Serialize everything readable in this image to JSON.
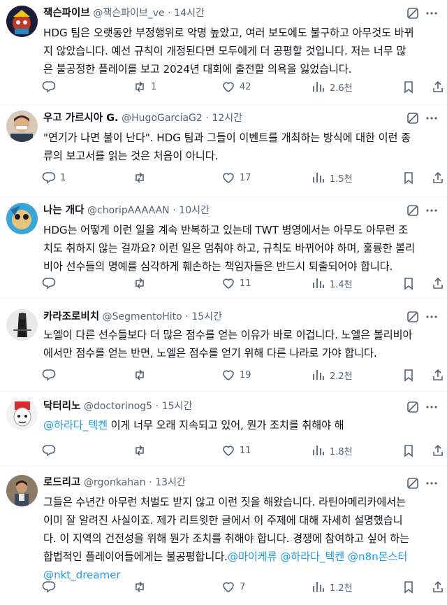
{
  "tweets": [
    {
      "name": "잭슨파이브",
      "handle": "@잭슨파이브_ve",
      "dot": "·",
      "time": "14시간",
      "text": [
        "HDG 팀은 오랫동안 부정행위로 악명 높았고, 여러 보도에도 불구하고 아무것도 바뀌",
        "지 않았습니다. 예선 규칙이 개정된다면 모두에게 더 공평할 것입니다. 저는 너무 많",
        "은 불공정한 플레이를 보고 2024년 대회에 출전할 의욕을 잃었습니다."
      ],
      "replies": "",
      "retweets": "1",
      "likes": "42",
      "views": "2.6천"
    },
    {
      "name": "우고 가르시아 G.",
      "handle": "@HugoGarciaG2",
      "dot": "·",
      "time": "12시간",
      "text": [
        "\"연기가 나면 불이 난다\". HDG 팀과 그들이 이벤트를 개최하는 방식에 대한 이런 종",
        "류의 보고서를 읽는 것은 처음이 아니다."
      ],
      "replies": "1",
      "retweets": "",
      "likes": "17",
      "views": "1.5천"
    },
    {
      "name": "나는 개다",
      "handle": "@choripAAAAAN",
      "dot": "·",
      "time": "10시간",
      "text": [
        "HDG는 어떻게 이런 일을 계속 반복하고 있는데 TWT 병영에서는 아무도 아무런 조",
        "치도 취하지 않는 걸까요? 이런 일은 멈춰야 하고, 규칙도 바뀌어야 하며, 훌륭한 볼리",
        "비아 선수들의 명예를 심각하게 훼손하는 책임자들은 반드시 퇴출되어야 합니다."
      ],
      "replies": "",
      "retweets": "",
      "likes": "11",
      "views": "1.4천"
    },
    {
      "name": "카라조로비치",
      "handle": "@SegmentoHito",
      "dot": "·",
      "time": "15시간",
      "text": [
        "노엘이 다른 선수들보다 더 많은 점수를 얻는 이유가 바로 이겁니다. 노엘은 볼리비아",
        "에서만 점수를 얻는 반면, 노엘은 점수를 얻기 위해 다른 나라로 가야 합니다."
      ],
      "replies": "",
      "retweets": "",
      "likes": "19",
      "views": "2.2천"
    },
    {
      "name": "닥터리노",
      "handle": "@doctorinog5",
      "dot": "·",
      "time": "15시간",
      "mention": "@하라다_텍켄",
      "text": [
        " 이게 너무 오래 지속되고 있어, 뭔가 조치를 취해야 해"
      ],
      "replies": "",
      "retweets": "",
      "likes": "11",
      "views": "1.8천"
    },
    {
      "name": "로드리고",
      "handle": "@rgonkahan",
      "dot": "·",
      "time": "13시간",
      "text": [
        "그들은 수년간 아무런 처벌도 받지 않고 이런 짓을 해왔습니다. 라틴아메리카에서는",
        "이미 잘 알려진 사실이죠. 제가 리트윗한 글에서 이 주제에 대해 자세히 설명했습니",
        "다. 이 지역의 건전성을 위해 뭔가 조치를 취해야 합니다. 경쟁에 참여하고 싶어 하는",
        "합법적인 플레이어들에게는 불공평합니다."
      ],
      "trailing_mentions": [
        "@마이케류",
        "@하라다_텍켄",
        "@n8n몬스터",
        "@nkt_dreamer"
      ],
      "replies": "",
      "retweets": "",
      "likes": "7",
      "views": "1.2천"
    }
  ],
  "colors": {
    "text": "#0f1419",
    "muted": "#536471",
    "link": "#1d9bf0",
    "divider": "#eff3f4"
  },
  "icons": [
    "grok-icon",
    "more-icon",
    "reply-icon",
    "retweet-icon",
    "like-icon",
    "views-icon",
    "bookmark-icon",
    "share-icon"
  ]
}
